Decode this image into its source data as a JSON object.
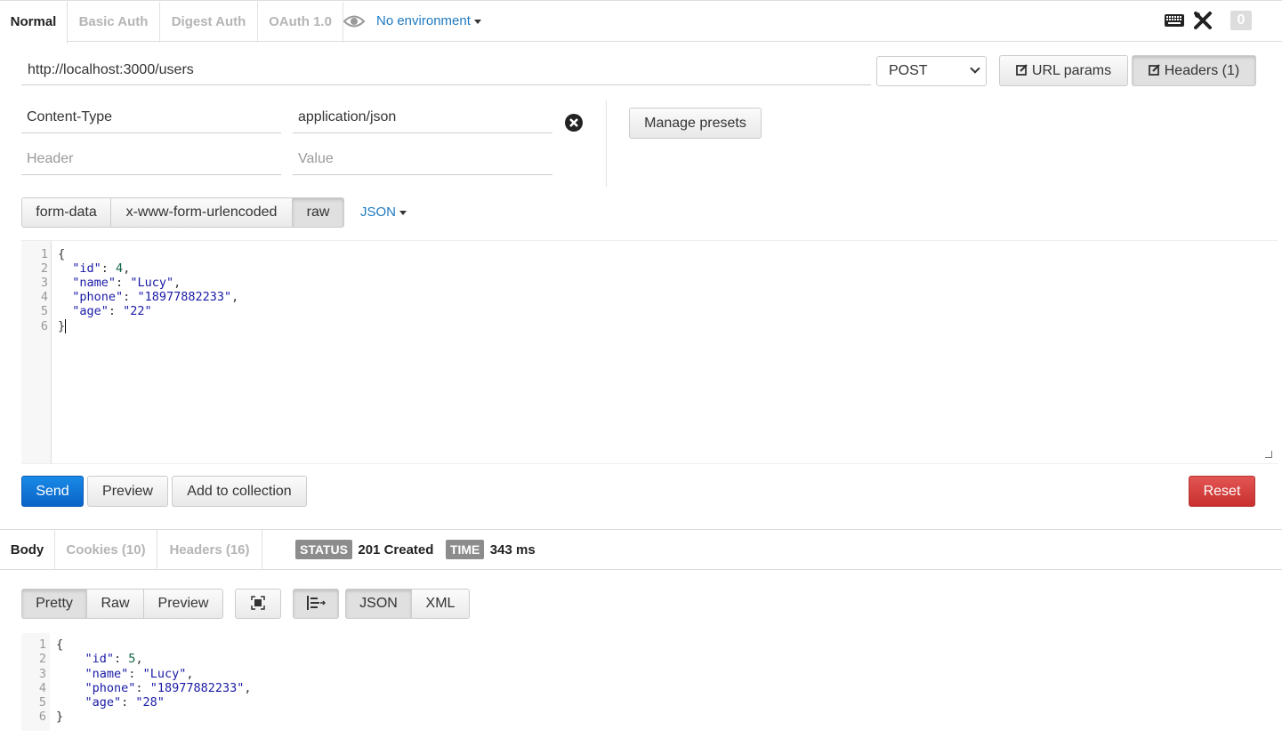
{
  "auth_tabs": [
    "Normal",
    "Basic Auth",
    "Digest Auth",
    "OAuth 1.0"
  ],
  "environment": "No environment",
  "toolbar_count": "0",
  "request": {
    "url": "http://localhost:3000/users",
    "method": "POST",
    "url_params_label": "URL params",
    "headers_label": "Headers (1)",
    "headers": [
      {
        "key": "Content-Type",
        "value": "application/json"
      }
    ],
    "header_placeholder": "Header",
    "value_placeholder": "Value",
    "manage_presets": "Manage presets",
    "body_modes": [
      "form-data",
      "x-www-form-urlencoded",
      "raw"
    ],
    "raw_format": "JSON",
    "line_numbers": [
      "1",
      "2",
      "3",
      "4",
      "5",
      "6"
    ]
  },
  "actions": {
    "send": "Send",
    "preview": "Preview",
    "add_to_collection": "Add to collection",
    "reset": "Reset"
  },
  "response": {
    "tabs": [
      "Body",
      "Cookies (10)",
      "Headers (16)"
    ],
    "status_label": "STATUS",
    "status_value": "201 Created",
    "time_label": "TIME",
    "time_value": "343 ms",
    "view_modes": [
      "Pretty",
      "Raw",
      "Preview"
    ],
    "formats": [
      "JSON",
      "XML"
    ],
    "line_numbers": [
      "1",
      "2",
      "3",
      "4",
      "5",
      "6"
    ]
  },
  "colors": {
    "send": "#0a63c7",
    "reset": "#c8302e",
    "link": "#1f7ac1"
  }
}
